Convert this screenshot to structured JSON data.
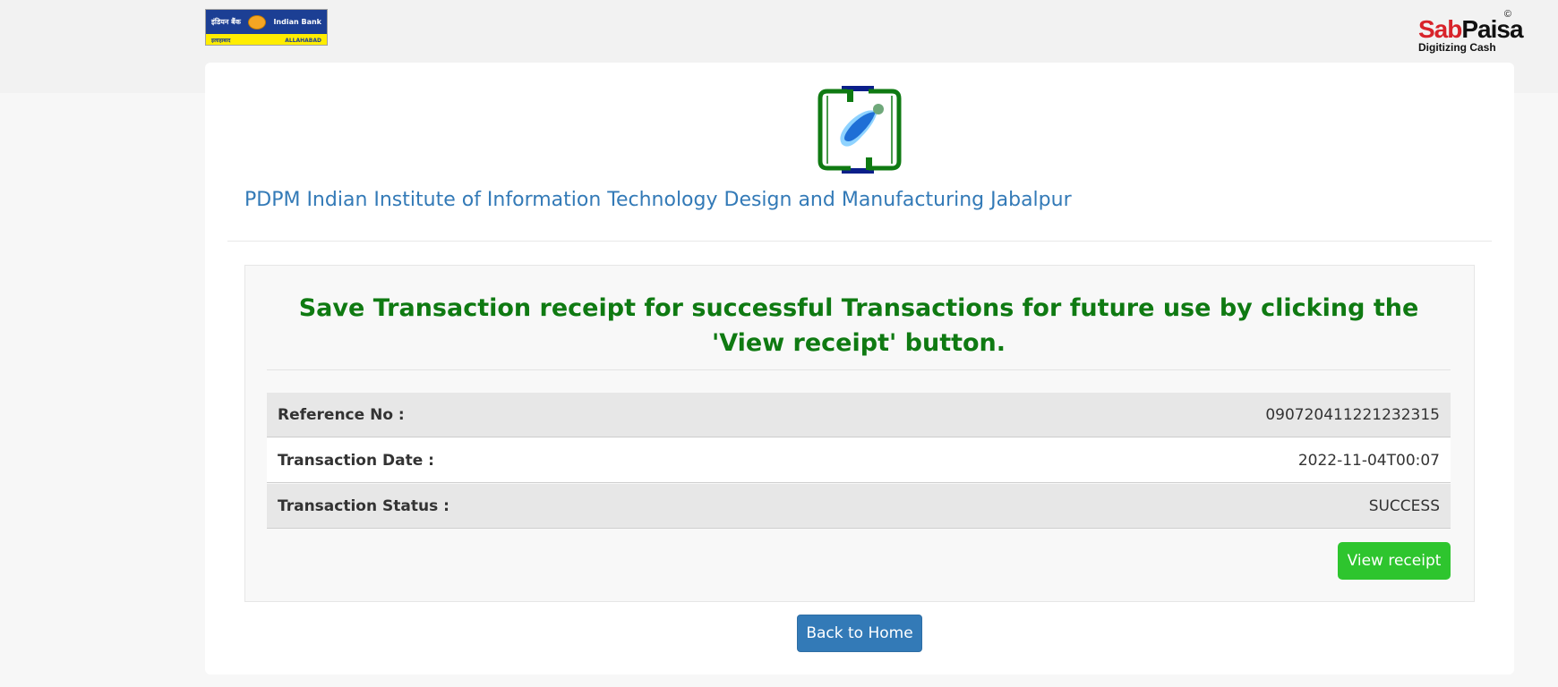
{
  "header": {
    "bank_logo": {
      "name_hindi": "इंडियन बैंक",
      "name_english": "Indian Bank",
      "sub_left": "इलाहाबाद",
      "sub_right": "ALLAHABAD"
    },
    "sabpaisa_logo": {
      "brand_part1": "Sab",
      "brand_part2": "Paisa",
      "copyright": "©",
      "tagline": "Digitizing Cash"
    }
  },
  "institute": {
    "name": "PDPM Indian Institute of Information Technology Design and Manufacturing Jabalpur"
  },
  "notice": {
    "text": "Save Transaction receipt for successful Transactions for future use by clicking the 'View receipt' button."
  },
  "details": [
    {
      "label": "Reference No :",
      "value": "090720411221232315"
    },
    {
      "label": "Transaction Date :",
      "value": "2022-11-04T00:07"
    },
    {
      "label": "Transaction Status :",
      "value": "SUCCESS"
    }
  ],
  "buttons": {
    "view_receipt": "View receipt",
    "back_home": "Back to Home"
  },
  "colors": {
    "notice_green": "#0f7a12",
    "view_button": "#2ec52e",
    "home_button": "#337ab7",
    "institute_text": "#337ab7"
  }
}
